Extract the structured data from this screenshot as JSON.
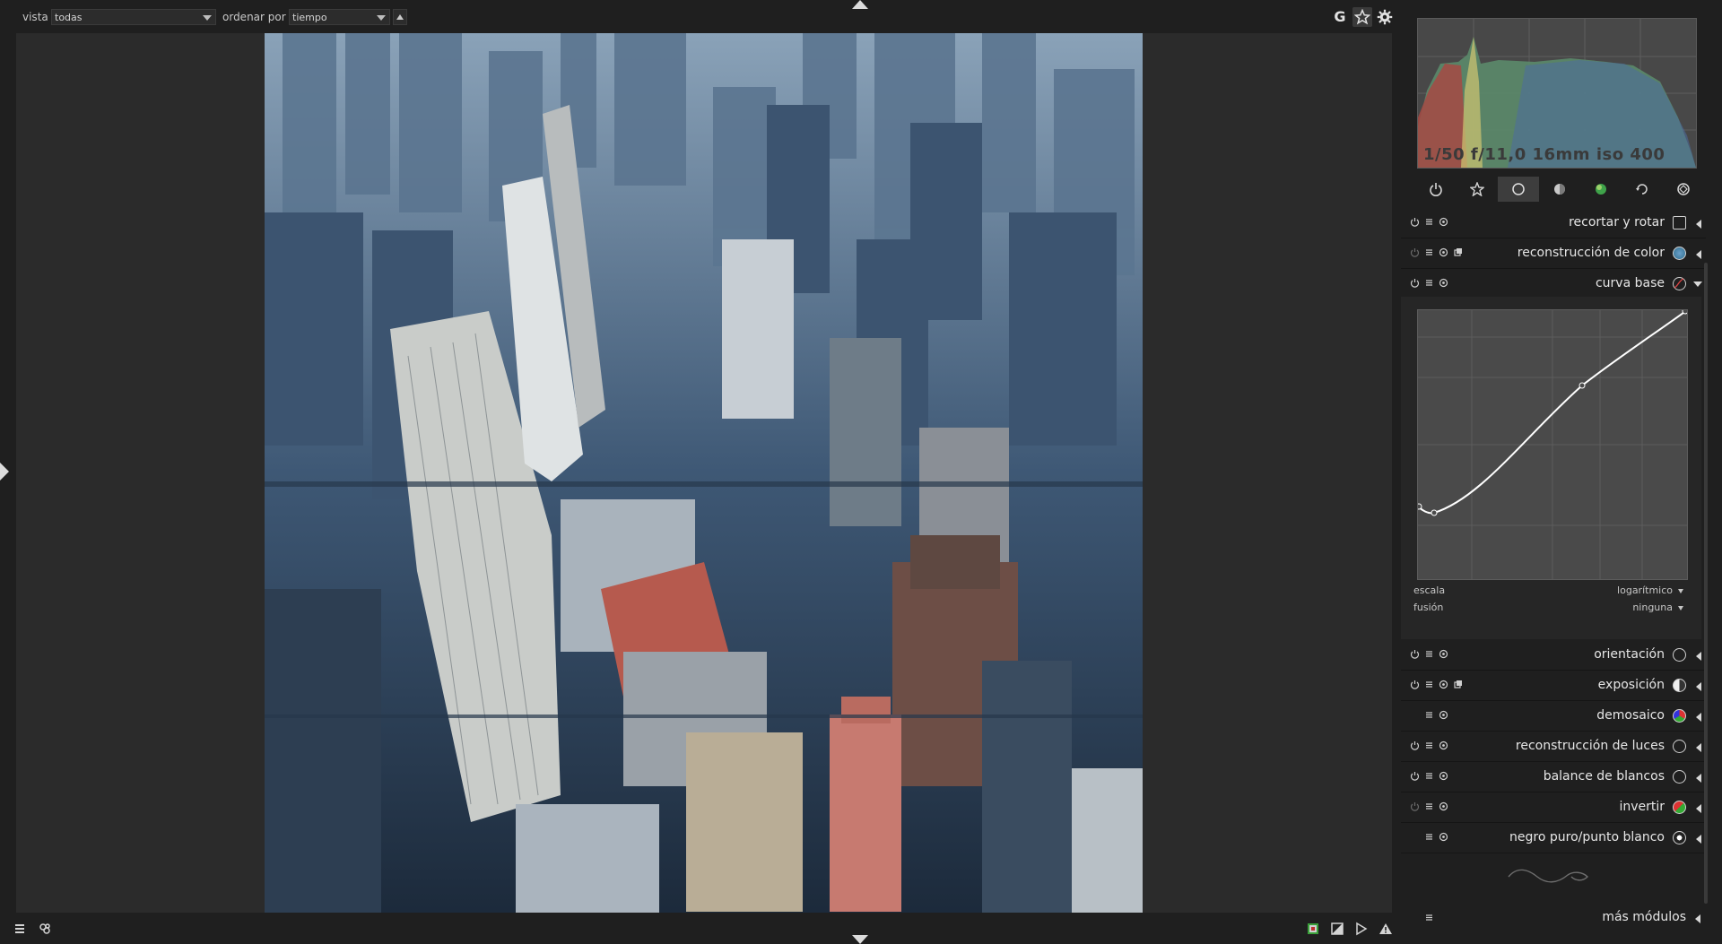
{
  "topbar": {
    "view_label": "vista",
    "view_value": "todas",
    "sort_label": "ordenar por",
    "sort_value": "tiempo",
    "icons": [
      "grouping-icon",
      "star-icon",
      "gear-icon"
    ],
    "grouping_text": "G"
  },
  "histogram": {
    "exif": "1/50 f/11,0 16mm iso 400"
  },
  "module_groups": [
    "power-icon",
    "favorite-icon",
    "basic-icon",
    "tone-icon",
    "color-icon",
    "correct-icon",
    "effects-icon"
  ],
  "modules_top": [
    {
      "label": "recortar y rotar",
      "expanded": false
    },
    {
      "label": "reconstrucción de color",
      "expanded": false
    },
    {
      "label": "curva base",
      "expanded": true
    }
  ],
  "curve_base": {
    "scale_label": "escala",
    "scale_value": "logarítmico",
    "blend_label": "fusión",
    "blend_value": "ninguna"
  },
  "modules_bottom": [
    {
      "label": "orientación"
    },
    {
      "label": "exposición"
    },
    {
      "label": "demosaico"
    },
    {
      "label": "reconstrucción de luces"
    },
    {
      "label": "balance de blancos"
    },
    {
      "label": "invertir"
    },
    {
      "label": "negro puro/punto blanco"
    }
  ],
  "more_modules": "más módulos",
  "colors": {
    "accent_active_tab": "#3d3d3d",
    "curve": "#ffffff"
  }
}
